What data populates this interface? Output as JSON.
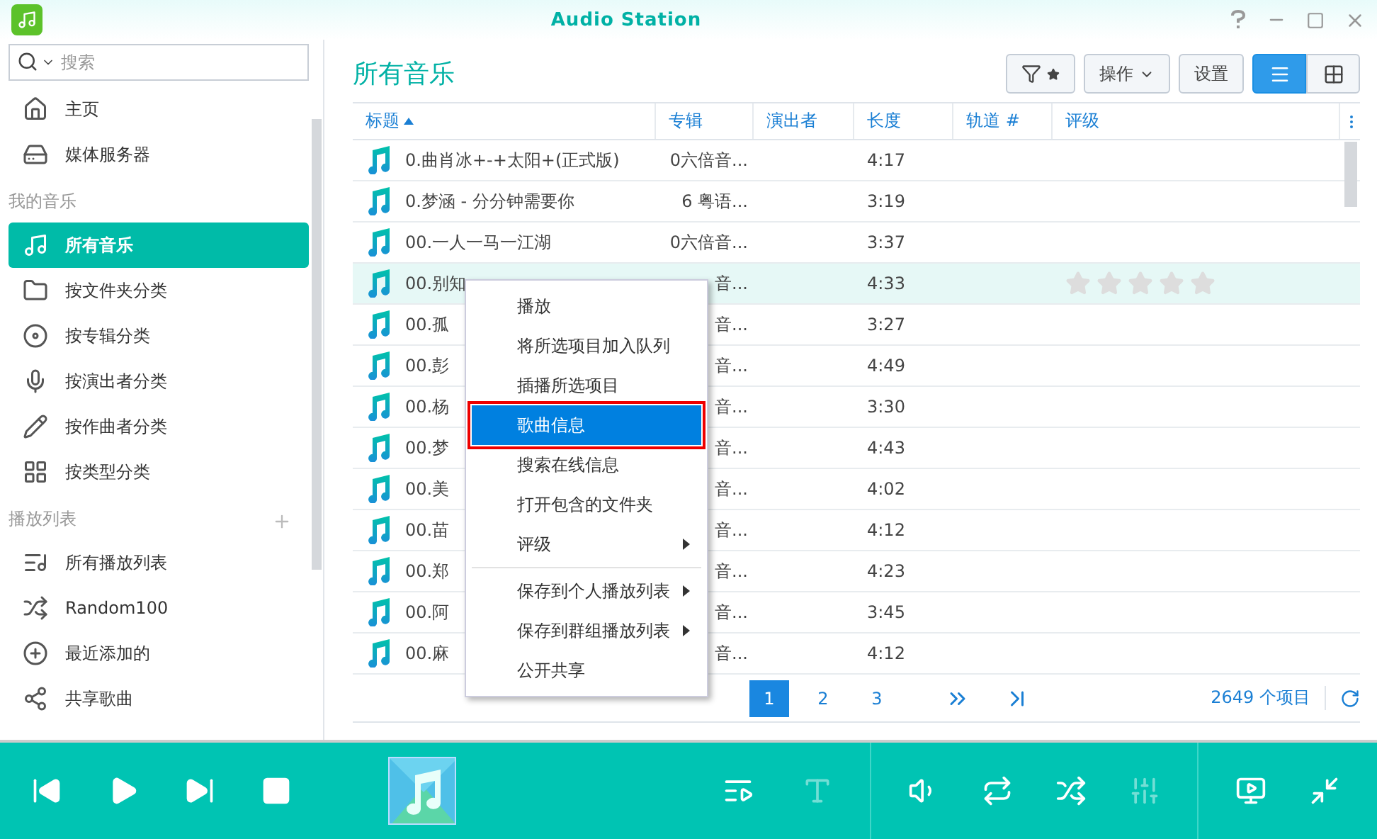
{
  "window": {
    "title": "Audio Station"
  },
  "search": {
    "placeholder": "搜索"
  },
  "sidebar": {
    "top_items": [
      {
        "label": "主页",
        "selected": false
      },
      {
        "label": "媒体服务器",
        "selected": false
      }
    ],
    "sections": [
      {
        "heading": "我的音乐",
        "add_button": false,
        "items": [
          {
            "label": "所有音乐",
            "selected": true
          },
          {
            "label": "按文件夹分类",
            "selected": false
          },
          {
            "label": "按专辑分类",
            "selected": false
          },
          {
            "label": "按演出者分类",
            "selected": false
          },
          {
            "label": "按作曲者分类",
            "selected": false
          },
          {
            "label": "按类型分类",
            "selected": false
          }
        ]
      },
      {
        "heading": "播放列表",
        "add_button": true,
        "items": [
          {
            "label": "所有播放列表",
            "selected": false
          },
          {
            "label": "Random100",
            "selected": false
          },
          {
            "label": "最近添加的",
            "selected": false
          },
          {
            "label": "共享歌曲",
            "selected": false
          }
        ]
      }
    ]
  },
  "page_title": "所有音乐",
  "toolbar": {
    "action_button": "操作",
    "settings_button": "设置",
    "views": [
      {
        "selected": true
      },
      {
        "selected": false
      }
    ]
  },
  "table": {
    "columns": [
      "标题",
      "专辑",
      "演出者",
      "长度",
      "轨道 #",
      "评级"
    ],
    "rows": [
      {
        "title": "0.曲肖冰+-+太阳+(正式版)",
        "album": "0六倍音...",
        "length": "4:17",
        "selected": false
      },
      {
        "title": "0.梦涵 - 分分钟需要你",
        "album": "6 粤语...",
        "length": "3:19",
        "selected": false
      },
      {
        "title": "00.一人一马一江湖",
        "album": "0六倍音...",
        "length": "3:37",
        "selected": false
      },
      {
        "title": "00.别知",
        "album": "音...",
        "length": "4:33",
        "selected": true,
        "stars": 0
      },
      {
        "title": "00.孤",
        "album": "音...",
        "length": "3:27",
        "selected": false
      },
      {
        "title": "00.彭",
        "album": "音...",
        "length": "4:49",
        "selected": false
      },
      {
        "title": "00.杨",
        "album": "音...",
        "length": "3:30",
        "selected": false
      },
      {
        "title": "00.梦",
        "album": "音...",
        "length": "4:43",
        "selected": false
      },
      {
        "title": "00.美",
        "album": "音...",
        "length": "4:02",
        "selected": false
      },
      {
        "title": "00.苗",
        "album": "音...",
        "length": "4:12",
        "selected": false
      },
      {
        "title": "00.郑",
        "album": "音...",
        "length": "4:23",
        "selected": false
      },
      {
        "title": "00.阿",
        "album": "音...",
        "length": "3:45",
        "selected": false
      },
      {
        "title": "00.麻",
        "album": "音...",
        "length": "4:12",
        "selected": false
      }
    ]
  },
  "pagination": {
    "pages": [
      {
        "label": "1",
        "selected": true
      },
      {
        "label": "2",
        "selected": false
      },
      {
        "label": "3",
        "selected": false
      }
    ],
    "count": "2649 个项目"
  },
  "context_menu": {
    "items": [
      {
        "label": "播放",
        "selected": false,
        "submenu": false,
        "divider_after": false
      },
      {
        "label": "将所选项目加入队列",
        "selected": false,
        "submenu": false,
        "divider_after": false
      },
      {
        "label": "插播所选项目",
        "selected": false,
        "submenu": false,
        "divider_after": false
      },
      {
        "label": "歌曲信息",
        "selected": true,
        "submenu": false,
        "divider_after": false
      },
      {
        "label": "搜索在线信息",
        "selected": false,
        "submenu": false,
        "divider_after": false
      },
      {
        "label": "打开包含的文件夹",
        "selected": false,
        "submenu": false,
        "divider_after": false
      },
      {
        "label": "评级",
        "selected": false,
        "submenu": true,
        "divider_after": true
      },
      {
        "label": "保存到个人播放列表",
        "selected": false,
        "submenu": true,
        "divider_after": false
      },
      {
        "label": "保存到群组播放列表",
        "selected": false,
        "submenu": true,
        "divider_after": false
      },
      {
        "label": "公开共享",
        "selected": false,
        "submenu": false,
        "divider_after": false
      }
    ]
  },
  "player": {
    "controls": [
      {
        "disabled": false
      },
      {
        "disabled": true
      },
      {
        "disabled": false
      },
      {
        "disabled": false
      },
      {
        "disabled": false
      },
      {
        "disabled": true
      },
      {
        "disabled": false
      },
      {
        "disabled": false
      }
    ]
  }
}
